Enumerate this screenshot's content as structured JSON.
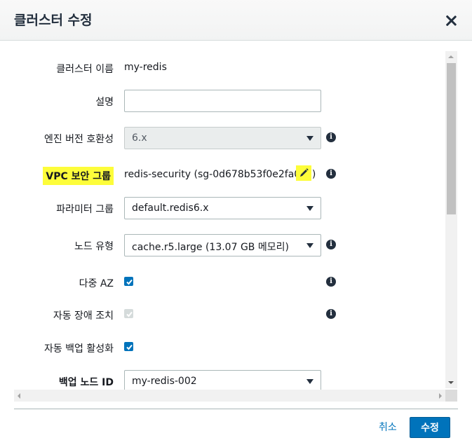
{
  "modal": {
    "title": "클러스터 수정"
  },
  "form": {
    "cluster_name": {
      "label": "클러스터 이름",
      "value": "my-redis"
    },
    "description": {
      "label": "설명",
      "value": ""
    },
    "engine_version": {
      "label": "엔진 버전 호환성",
      "value": "6.x",
      "disabled": true
    },
    "vpc_security_group": {
      "label": "VPC 보안 그룹",
      "value": "redis-security (sg-0d678b53f0e2fa05c)"
    },
    "parameter_group": {
      "label": "파라미터 그룹",
      "value": "default.redis6.x"
    },
    "node_type": {
      "label": "노드 유형",
      "value": "cache.r5.large (13.07 GB 메모리)"
    },
    "multi_az": {
      "label": "다중 AZ",
      "checked": true
    },
    "auto_failover": {
      "label": "자동 장애 조치",
      "checked": true,
      "disabled": true
    },
    "auto_backup": {
      "label": "자동 백업 활성화",
      "checked": true
    },
    "backup_node_id": {
      "label": "백업 노드 ID",
      "value": "my-redis-002"
    }
  },
  "icons": {
    "info": "info-icon",
    "edit": "pencil-icon",
    "close": "close-icon"
  },
  "footer": {
    "cancel_label": "취소",
    "submit_label": "수정"
  },
  "colors": {
    "primary": "#0073bb",
    "highlight": "#fdfd3a",
    "header_bg": "#f2f3f3",
    "disabled_bg": "#eaeded"
  }
}
